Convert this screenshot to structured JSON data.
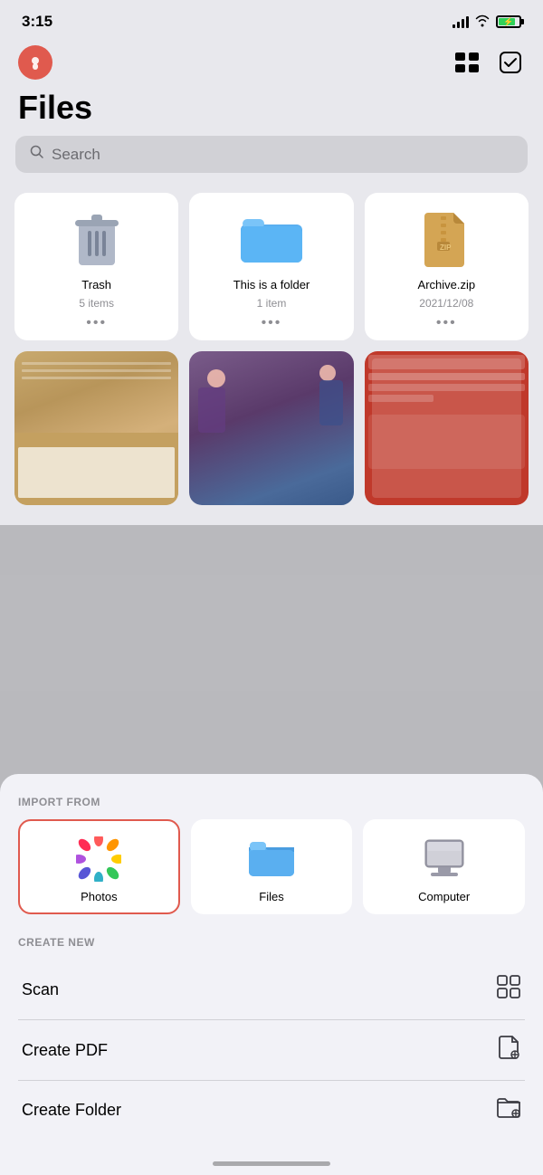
{
  "statusBar": {
    "time": "3:15"
  },
  "header": {
    "gridViewLabel": "Grid View",
    "checkboxLabel": "Select"
  },
  "page": {
    "title": "Files",
    "searchPlaceholder": "Search"
  },
  "fileGrid": {
    "items": [
      {
        "name": "Trash",
        "meta": "5 items",
        "type": "trash"
      },
      {
        "name": "This is a folder",
        "meta": "1 item",
        "type": "folder"
      },
      {
        "name": "Archive.zip",
        "meta": "2021/12/08",
        "type": "zip"
      }
    ],
    "photos": [
      {
        "type": "receipt"
      },
      {
        "type": "people"
      },
      {
        "type": "screenshot"
      }
    ],
    "moreLabel": "•••"
  },
  "bottomSheet": {
    "importSection": {
      "label": "IMPORT FROM",
      "items": [
        {
          "id": "photos",
          "label": "Photos",
          "selected": true
        },
        {
          "id": "files",
          "label": "Files",
          "selected": false
        },
        {
          "id": "computer",
          "label": "Computer",
          "selected": false
        }
      ]
    },
    "createSection": {
      "label": "CREATE NEW",
      "items": [
        {
          "id": "scan",
          "label": "Scan"
        },
        {
          "id": "create-pdf",
          "label": "Create PDF"
        },
        {
          "id": "create-folder",
          "label": "Create Folder"
        }
      ]
    }
  }
}
